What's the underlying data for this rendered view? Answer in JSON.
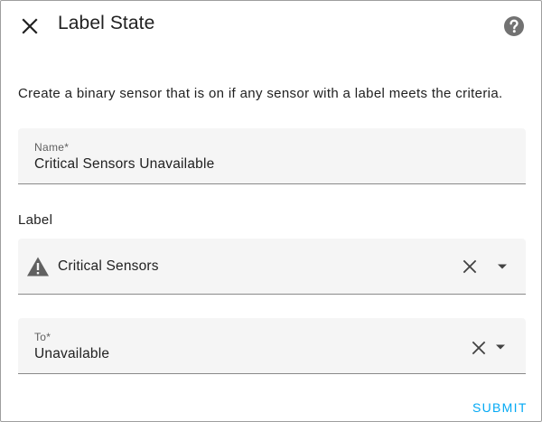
{
  "dialog": {
    "title": "Label State",
    "description": "Create a binary sensor that is on if any sensor with a label meets the criteria."
  },
  "name_field": {
    "label": "Name*",
    "value": "Critical Sensors Unavailable"
  },
  "label_section": {
    "heading": "Label",
    "selected_value": "Critical Sensors",
    "icon": "alert-triangle-icon"
  },
  "to_field": {
    "label": "To*",
    "value": "Unavailable"
  },
  "actions": {
    "submit_label": "SUBMIT"
  },
  "colors": {
    "accent": "#03a9f4",
    "field_background": "#f5f5f5",
    "help_icon": "#727272",
    "text_primary": "#212121",
    "text_secondary": "#5f5f5f"
  }
}
